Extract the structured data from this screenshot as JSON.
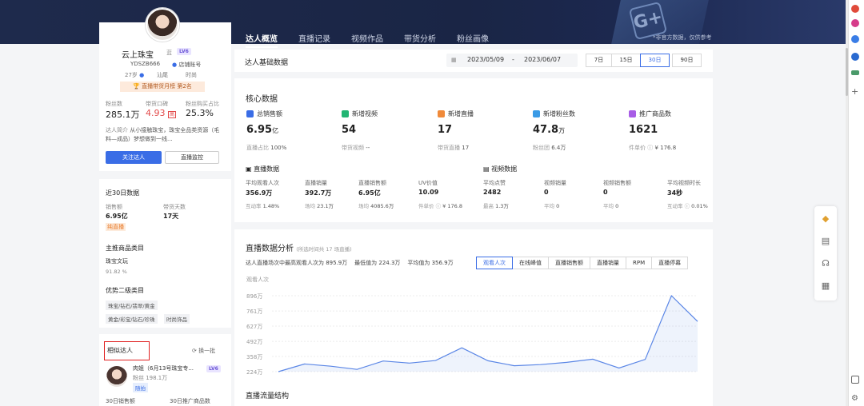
{
  "header": {
    "tabs": [
      "达人概览",
      "直播记录",
      "视频作品",
      "带货分析",
      "粉丝画像"
    ],
    "active_tab": 0,
    "note": "*非官方数据，仅供参考"
  },
  "profile": {
    "name": "云上珠宝",
    "verify": "蓝",
    "level": "LV6",
    "id": "YDSZB666",
    "account_type": "店铺账号",
    "age": "27岁",
    "region": "汕尾",
    "tag": "时尚",
    "rank": "直播带货月榜 第2名",
    "stats": [
      {
        "label": "粉丝数",
        "value": "285.1万"
      },
      {
        "label": "带货口碑",
        "value": "4.93",
        "badge": "高"
      },
      {
        "label": "粉丝购买占比",
        "value": "25.3%"
      }
    ],
    "intro_label": "达人简介",
    "intro": "从小接触珠宝，珠宝全品类资源（毛料—成品）梦想做到一线...",
    "follow_btn": "关注达人",
    "monitor_btn": "直播监控"
  },
  "recent30": {
    "title": "近30日数据",
    "sales_label": "销售额",
    "sales_value": "6.95亿",
    "days_label": "带货天数",
    "days_value": "17天",
    "tag": "纯直播",
    "main_cat_title": "主推商品类目",
    "main_cat": "珠宝文玩",
    "main_cat_pct": "91.82 %",
    "sub_cat_title": "优势二级类目",
    "sub_cats": [
      "珠宝/钻石/翡翠/黄金",
      "黄金/彩宝/钻石/珍珠",
      "时尚饰品"
    ]
  },
  "similar": {
    "title": "相似达人",
    "refresh": "换一批",
    "item": {
      "name": "肉姐（6月13号珠宝专...",
      "level": "LV6",
      "fans": "粉丝 198.1万",
      "tag": "随拍"
    },
    "footer_left": "30日销售额",
    "footer_right": "30日推广商品数"
  },
  "basic": {
    "title": "达人基础数据",
    "date_start": "2023/05/09",
    "date_sep": "-",
    "date_end": "2023/06/07",
    "ranges": [
      "7日",
      "15日",
      "30日",
      "90日"
    ],
    "active_range": 2
  },
  "core": {
    "title": "核心数据",
    "cards": [
      {
        "label": "总销售额",
        "value": "6.95",
        "unit": "亿",
        "sub_label": "直播占比",
        "sub_value": "100%",
        "color": "#3a6de6"
      },
      {
        "label": "新增视频",
        "value": "54",
        "unit": "",
        "sub_label": "带货视频",
        "sub_value": "--",
        "color": "#22b573"
      },
      {
        "label": "新增直播",
        "value": "17",
        "unit": "",
        "sub_label": "带货直播",
        "sub_value": "17",
        "color": "#f08a3a"
      },
      {
        "label": "新增粉丝数",
        "value": "47.8",
        "unit": "万",
        "sub_label": "粉丝团",
        "sub_value": "6.4万",
        "color": "#3a9be6"
      },
      {
        "label": "推广商品数",
        "value": "1621",
        "unit": "",
        "sub_label": "件单价 ⓘ",
        "sub_value": "¥ 176.8",
        "color": "#a85de6"
      }
    ],
    "live_title": "直播数据",
    "live": [
      {
        "label": "平均观看人次",
        "value": "356.9万",
        "sub_label": "互动率",
        "sub_value": "1.48%"
      },
      {
        "label": "直播销量",
        "value": "392.7万",
        "sub_label": "场均",
        "sub_value": "23.1万"
      },
      {
        "label": "直播销售额",
        "value": "6.95亿",
        "sub_label": "场均",
        "sub_value": "4085.6万"
      },
      {
        "label": "UV价值",
        "value": "10.09",
        "sub_label": "件单价 ⓘ",
        "sub_value": "¥ 176.8"
      }
    ],
    "video_title": "视频数据",
    "video": [
      {
        "label": "平均点赞",
        "value": "2482",
        "sub_label": "最高",
        "sub_value": "1.3万"
      },
      {
        "label": "视频销量",
        "value": "0",
        "sub_label": "平均",
        "sub_value": "0"
      },
      {
        "label": "视频销售额",
        "value": "0",
        "sub_label": "平均",
        "sub_value": "0"
      },
      {
        "label": "平均视频时长",
        "value": "34秒",
        "sub_label": "互动率 ⓘ",
        "sub_value": "0.01%"
      }
    ]
  },
  "analysis": {
    "title": "直播数据分析",
    "subtitle": "(所选时间共 17 场直播)",
    "summary": "达人直播场次中最高观看人次为 895.9万",
    "min_label": "最低值为 224.3万",
    "avg_label": "平均值为 356.9万",
    "metric_tabs": [
      "观看人次",
      "在线峰值",
      "直播销售额",
      "直播销量",
      "RPM",
      "直播停幕"
    ],
    "active_metric": 0,
    "flow_title": "直播流量结构"
  },
  "chart_data": {
    "type": "area",
    "ylabel": "观看人次",
    "y_ticks": [
      "896万",
      "761万",
      "627万",
      "492万",
      "358万",
      "224万"
    ],
    "ylim": [
      224,
      896
    ],
    "x": [
      1,
      2,
      3,
      4,
      5,
      6,
      7,
      8,
      9,
      10,
      11,
      12,
      13,
      14,
      15,
      16,
      17
    ],
    "values": [
      224,
      292,
      272,
      244,
      318,
      300,
      322,
      435,
      320,
      276,
      286,
      306,
      334,
      256,
      332,
      896,
      668
    ],
    "color": "#5a86e6",
    "grid": true
  }
}
